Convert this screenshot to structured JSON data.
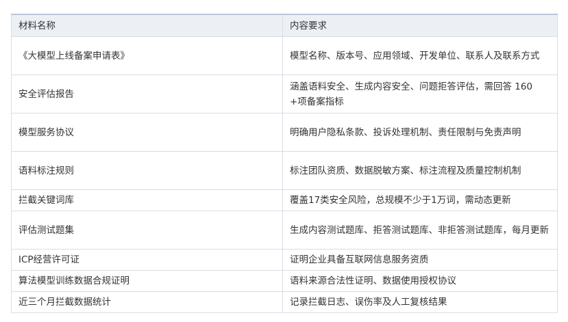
{
  "table": {
    "headers": [
      "材料名称",
      "内容要求"
    ],
    "rows": [
      {
        "name": "《大模型上线备案申请表》",
        "requirement": "模型名称、版本号、应用领域、开发单位、联系人及联系方式"
      },
      {
        "name": "安全评估报告",
        "requirement": "涵盖语料安全、生成内容安全、问题拒答评估，需回答 160 +项备案指标"
      },
      {
        "name": "模型服务协议",
        "requirement": "明确用户隐私条款、投诉处理机制、责任限制与免责声明"
      },
      {
        "name": "语料标注规则",
        "requirement": "标注团队资质、数据脱敏方案、标注流程及质量控制机制"
      },
      {
        "name": "拦截关键词库",
        "requirement": "覆盖17类安全风险，总规模不少于1万词，需动态更新"
      },
      {
        "name": "评估测试题集",
        "requirement": "生成内容测试题库、拒答测试题库、非拒答测试题库，每月更新"
      },
      {
        "name": "ICP经营许可证",
        "requirement": "证明企业具备互联网信息服务资质"
      },
      {
        "name": "算法模型训练数据合规证明",
        "requirement": "语料来源合法性证明、数据使用授权协议"
      },
      {
        "name": "近三个月拦截数据统计",
        "requirement": "记录拦截日志、误伤率及人工复核结果"
      }
    ]
  }
}
